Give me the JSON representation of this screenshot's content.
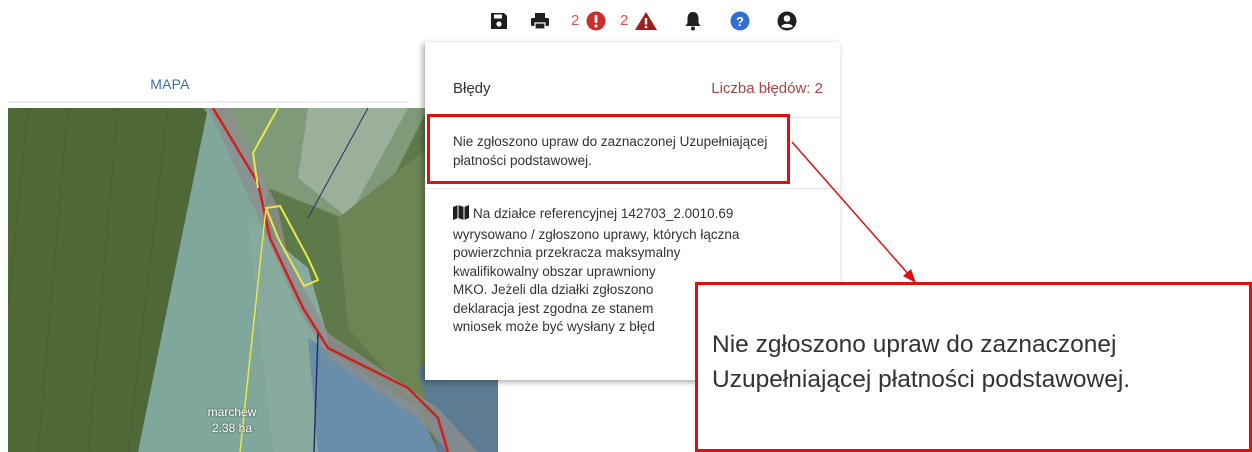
{
  "toolbar": {
    "save_icon": "floppy-disk-icon",
    "print_icon": "printer-icon",
    "errors_count": "2",
    "errors_icon": "exclamation-circle-icon",
    "warnings_count": "2",
    "warnings_icon": "warning-triangle-icon",
    "notifications_icon": "bell-icon",
    "help_icon": "question-circle-icon",
    "user_icon": "user-circle-icon",
    "colors": {
      "icon": "#1f1f1f",
      "error": "#c9302c",
      "warning": "#a11c1c",
      "help": "#2f6fd6"
    }
  },
  "tabs": {
    "map_label": "MAPA"
  },
  "map": {
    "parcel_label": "marchew",
    "parcel_area": "2.38 ha"
  },
  "panel": {
    "title": "Błędy",
    "count_label": "Liczba błędów: 2",
    "errors": [
      {
        "text": "Nie zgłoszono upraw do zaznaczonej Uzupełniającej płatności podstawowej."
      },
      {
        "icon": "map-icon",
        "lines": [
          "Na działce referencyjnej 142703_2.0010.69",
          "wyrysowano / zgłoszono uprawy, których łączna",
          "powierzchnia przekracza maksymalny",
          "kwalifikowalny obszar uprawniony",
          "MKO. Jeżeli dla działki zgłoszono",
          "deklaracja jest zgodna ze stanem",
          "wniosek może być wysłany z błęd"
        ]
      }
    ]
  },
  "zoom": {
    "line1": "Nie zgłoszono upraw do zaznaczonej",
    "line2": "Uzupełniającej płatności podstawowej."
  }
}
